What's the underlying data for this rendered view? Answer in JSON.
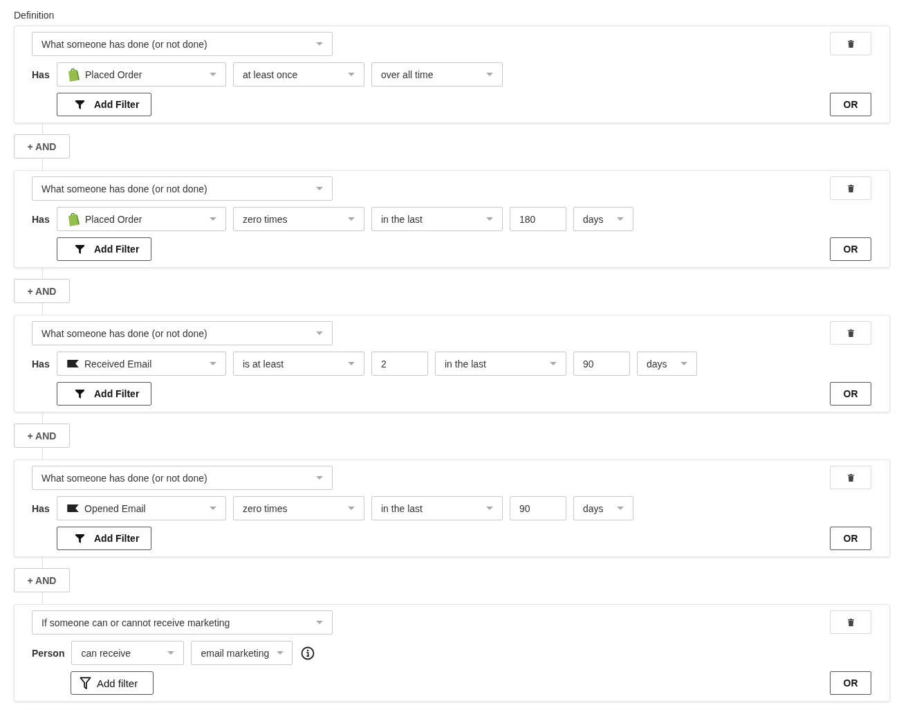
{
  "heading": "Definition",
  "conditions": [
    {
      "type": "What someone has done (or not done)",
      "row_label": "Has",
      "fields": [
        {
          "kind": "shop-event",
          "value": "Placed Order"
        },
        {
          "kind": "select",
          "value": "at least once"
        },
        {
          "kind": "select",
          "value": "over all time"
        }
      ],
      "filter_button": {
        "kind": "solid",
        "label": "Add Filter"
      },
      "info": false,
      "or_label": "OR",
      "and_label": "+ AND"
    },
    {
      "type": "What someone has done (or not done)",
      "row_label": "Has",
      "fields": [
        {
          "kind": "shop-event",
          "value": "Placed Order"
        },
        {
          "kind": "select",
          "value": "zero times"
        },
        {
          "kind": "select",
          "value": "in the last"
        },
        {
          "kind": "number",
          "value": "180"
        },
        {
          "kind": "unit",
          "value": "days"
        }
      ],
      "filter_button": {
        "kind": "solid",
        "label": "Add Filter"
      },
      "info": false,
      "or_label": "OR",
      "and_label": "+ AND"
    },
    {
      "type": "What someone has done (or not done)",
      "row_label": "Has",
      "fields": [
        {
          "kind": "email-event",
          "value": "Received Email"
        },
        {
          "kind": "select",
          "value": "is at least"
        },
        {
          "kind": "number",
          "value": "2"
        },
        {
          "kind": "select",
          "value": "in the last"
        },
        {
          "kind": "number",
          "value": "90"
        },
        {
          "kind": "unit",
          "value": "days"
        }
      ],
      "filter_button": {
        "kind": "solid",
        "label": "Add Filter"
      },
      "info": false,
      "or_label": "OR",
      "and_label": "+ AND"
    },
    {
      "type": "What someone has done (or not done)",
      "row_label": "Has",
      "fields": [
        {
          "kind": "email-event",
          "value": "Opened Email"
        },
        {
          "kind": "select",
          "value": "zero times"
        },
        {
          "kind": "select",
          "value": "in the last"
        },
        {
          "kind": "number",
          "value": "90"
        },
        {
          "kind": "unit",
          "value": "days"
        }
      ],
      "filter_button": {
        "kind": "solid",
        "label": "Add Filter"
      },
      "info": false,
      "or_label": "OR",
      "and_label": "+ AND"
    },
    {
      "type": "If someone can or cannot receive marketing",
      "row_label": "Person",
      "fields": [
        {
          "kind": "choice",
          "value": "can receive"
        },
        {
          "kind": "short",
          "value": "email marketing"
        }
      ],
      "filter_button": {
        "kind": "outline",
        "label": "Add filter"
      },
      "info": true,
      "or_label": "OR"
    }
  ]
}
